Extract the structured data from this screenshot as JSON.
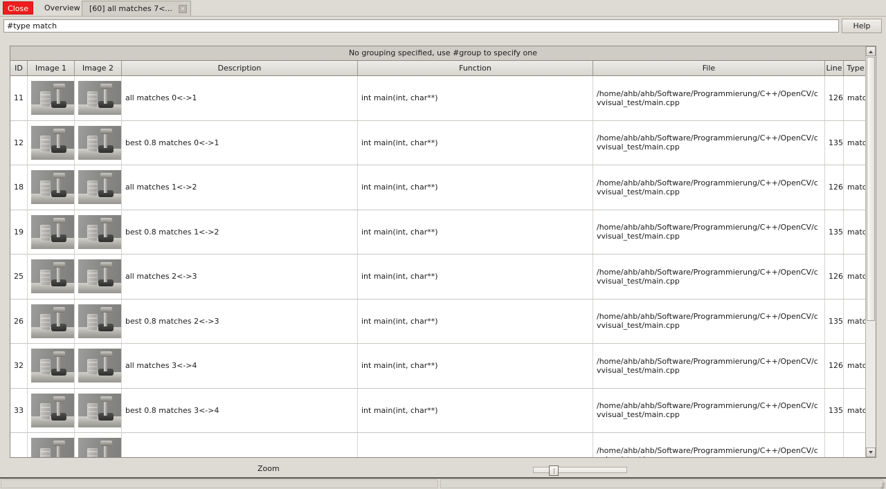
{
  "window": {
    "close_label": "Close"
  },
  "tabs": [
    {
      "label": "Overview",
      "active": false
    },
    {
      "label": "[60] all matches 7<...",
      "active": true,
      "close_glyph": "×"
    }
  ],
  "filter": {
    "value": "#type match",
    "placeholder": "",
    "help_label": "Help"
  },
  "table": {
    "group_note": "No grouping specified, use #group to specify one",
    "columns": [
      {
        "key": "id",
        "label": "ID"
      },
      {
        "key": "image1",
        "label": "Image 1"
      },
      {
        "key": "image2",
        "label": "Image 2"
      },
      {
        "key": "description",
        "label": "Description"
      },
      {
        "key": "function",
        "label": "Function"
      },
      {
        "key": "file",
        "label": "File"
      },
      {
        "key": "line",
        "label": "Line"
      },
      {
        "key": "type",
        "label": "Type"
      }
    ],
    "rows": [
      {
        "id": "11",
        "description": "all matches 0<->1",
        "function": "int main(int, char**)",
        "file": "/home/ahb/ahb/Software/Programmierung/C++/OpenCV/cvvisual_test/main.cpp",
        "line": "126",
        "type": "match"
      },
      {
        "id": "12",
        "description": "best 0.8 matches 0<->1",
        "function": "int main(int, char**)",
        "file": "/home/ahb/ahb/Software/Programmierung/C++/OpenCV/cvvisual_test/main.cpp",
        "line": "135",
        "type": "match"
      },
      {
        "id": "18",
        "description": "all matches 1<->2",
        "function": "int main(int, char**)",
        "file": "/home/ahb/ahb/Software/Programmierung/C++/OpenCV/cvvisual_test/main.cpp",
        "line": "126",
        "type": "match"
      },
      {
        "id": "19",
        "description": "best 0.8 matches 1<->2",
        "function": "int main(int, char**)",
        "file": "/home/ahb/ahb/Software/Programmierung/C++/OpenCV/cvvisual_test/main.cpp",
        "line": "135",
        "type": "match"
      },
      {
        "id": "25",
        "description": "all matches 2<->3",
        "function": "int main(int, char**)",
        "file": "/home/ahb/ahb/Software/Programmierung/C++/OpenCV/cvvisual_test/main.cpp",
        "line": "126",
        "type": "match"
      },
      {
        "id": "26",
        "description": "best 0.8 matches 2<->3",
        "function": "int main(int, char**)",
        "file": "/home/ahb/ahb/Software/Programmierung/C++/OpenCV/cvvisual_test/main.cpp",
        "line": "135",
        "type": "match"
      },
      {
        "id": "32",
        "description": "all matches 3<->4",
        "function": "int main(int, char**)",
        "file": "/home/ahb/ahb/Software/Programmierung/C++/OpenCV/cvvisual_test/main.cpp",
        "line": "126",
        "type": "match"
      },
      {
        "id": "33",
        "description": "best 0.8 matches 3<->4",
        "function": "int main(int, char**)",
        "file": "/home/ahb/ahb/Software/Programmierung/C++/OpenCV/cvvisual_test/main.cpp",
        "line": "135",
        "type": "match"
      },
      {
        "id": "",
        "description": "",
        "function": "",
        "file": "/home/ahb/ahb/Software/Programmierung/C++/OpenCV/cvvisual_test/",
        "line": "",
        "type": ""
      }
    ]
  },
  "zoom": {
    "label": "Zoom"
  },
  "statusbar": {
    "left_text": "",
    "right_text": ""
  },
  "colors": {
    "close_button": "#ee1d1d",
    "chrome": "#dedbd4",
    "header": "#d8d5ce"
  }
}
